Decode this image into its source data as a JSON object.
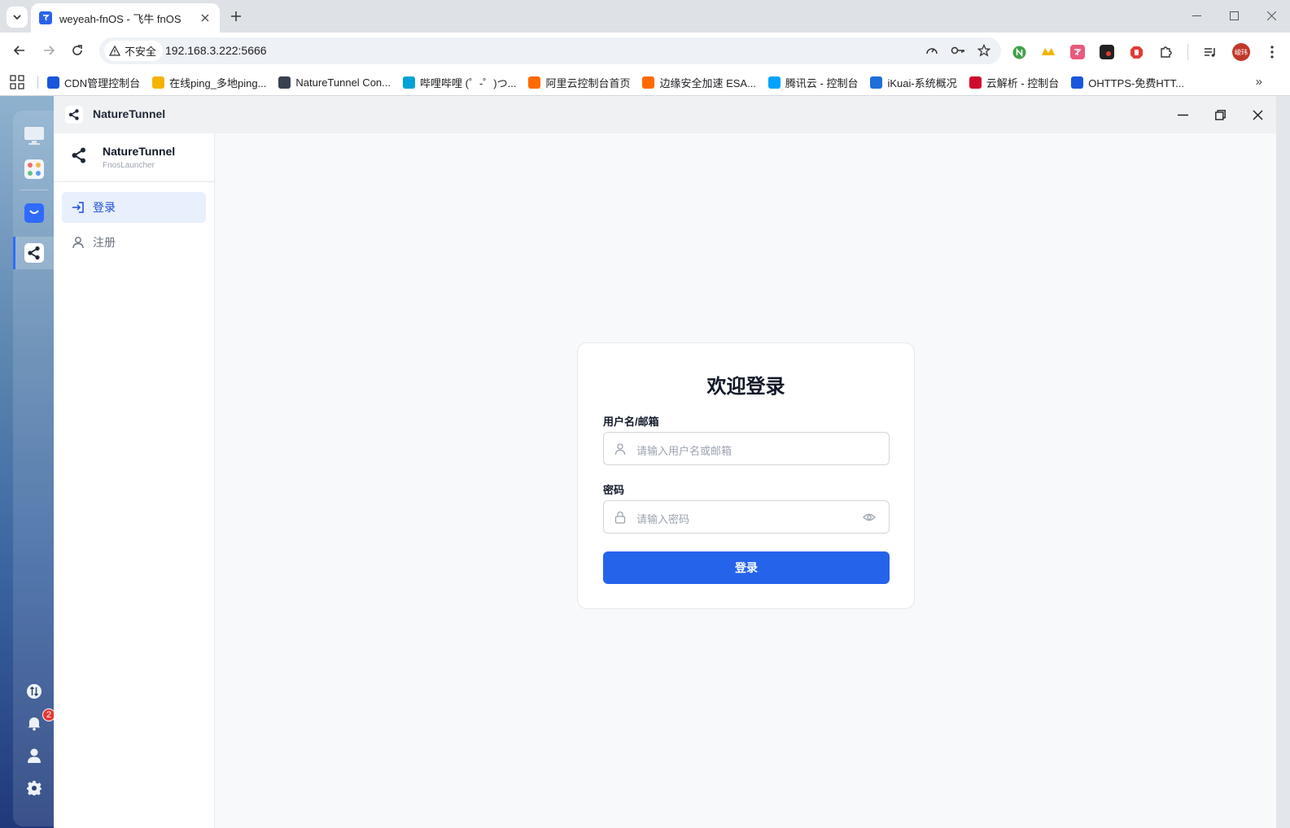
{
  "browser": {
    "tab_title": "weyeah-fnOS - 飞牛 fnOS",
    "insecure_label": "不安全",
    "url": "192.168.3.222:5666",
    "profile_initials": "峻玮",
    "bookmarks": [
      {
        "label": "CDN管理控制台",
        "icon": "cdn-icon",
        "color": "#1a56db"
      },
      {
        "label": "在线ping_多地ping...",
        "icon": "ping-icon",
        "color": "#f4b400"
      },
      {
        "label": "NatureTunnel Con...",
        "icon": "share-icon",
        "color": "#374151"
      },
      {
        "label": "哔哩哔哩 (゜-゜)つ...",
        "icon": "bilibili-icon",
        "color": "#00a1d6"
      },
      {
        "label": "阿里云控制台首页",
        "icon": "aliyun-icon",
        "color": "#ff6a00"
      },
      {
        "label": "边缘安全加速 ESA...",
        "icon": "aliyun-icon",
        "color": "#ff6a00"
      },
      {
        "label": "腾讯云 - 控制台",
        "icon": "tencent-cloud-icon",
        "color": "#00a3ff"
      },
      {
        "label": "iKuai-系统概况",
        "icon": "ikuai-icon",
        "color": "#1e6fd9"
      },
      {
        "label": "云解析 - 控制台",
        "icon": "huawei-icon",
        "color": "#cf0a2c"
      },
      {
        "label": "OHTTPS-免费HTT...",
        "icon": "ohttps-icon",
        "color": "#1a56db"
      }
    ]
  },
  "dock": {
    "notification_count": "2"
  },
  "app": {
    "window_title": "NatureTunnel",
    "brand_name": "NatureTunnel",
    "brand_sub": "FnosLauncher",
    "nav": [
      {
        "label": "登录",
        "active": true
      },
      {
        "label": "注册",
        "active": false
      }
    ],
    "login": {
      "title": "欢迎登录",
      "username_label": "用户名/邮箱",
      "username_placeholder": "请输入用户名或邮箱",
      "password_label": "密码",
      "password_placeholder": "请输入密码",
      "submit_label": "登录"
    }
  },
  "colors": {
    "accent": "#2563eb",
    "nav_active_bg": "#e8effd",
    "badge": "#e53935"
  }
}
